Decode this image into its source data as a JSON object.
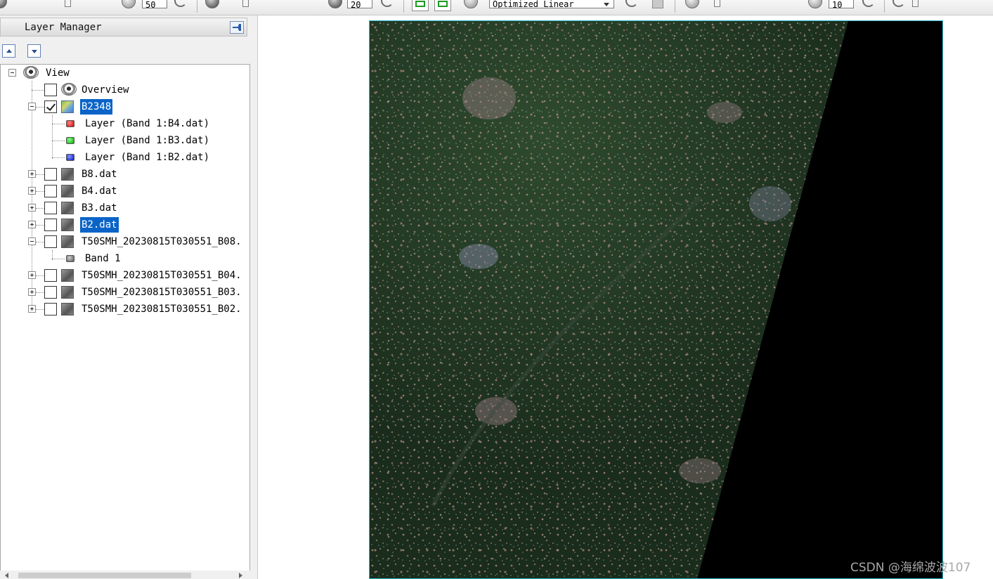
{
  "toolbar": {
    "brightness_value": "50",
    "contrast_value": "20",
    "stretch_type": "Optimized Linear",
    "sharpen_value": "10"
  },
  "layer_manager": {
    "title": "Layer Manager",
    "tree": {
      "root": {
        "label": "View"
      },
      "overview": {
        "label": "Overview",
        "checked": false
      },
      "b2348": {
        "label": "B2348",
        "checked": true,
        "bands": [
          {
            "label": "Layer (Band 1:B4.dat)",
            "color": "#d40000"
          },
          {
            "label": "Layer (Band 1:B3.dat)",
            "color": "#00a800"
          },
          {
            "label": "Layer (Band 1:B2.dat)",
            "color": "#0010c8"
          }
        ]
      },
      "b8": {
        "label": "B8.dat",
        "checked": false
      },
      "b4": {
        "label": "B4.dat",
        "checked": false
      },
      "b3": {
        "label": "B3.dat",
        "checked": false
      },
      "b2": {
        "label": "B2.dat",
        "checked": false
      },
      "t50_b08": {
        "label": "T50SMH_20230815T030551_B08.",
        "checked": false,
        "band": "Band 1"
      },
      "t50_b04": {
        "label": "T50SMH_20230815T030551_B04.",
        "checked": false
      },
      "t50_b03": {
        "label": "T50SMH_20230815T030551_B03.",
        "checked": false
      },
      "t50_b02": {
        "label": "T50SMH_20230815T030551_B02.",
        "checked": false
      }
    }
  },
  "watermark": "CSDN @海绵波波107",
  "colors": {
    "selection": "#0a64c8",
    "image_border": "#2bb7c9",
    "vegetation": "#1f3321"
  }
}
